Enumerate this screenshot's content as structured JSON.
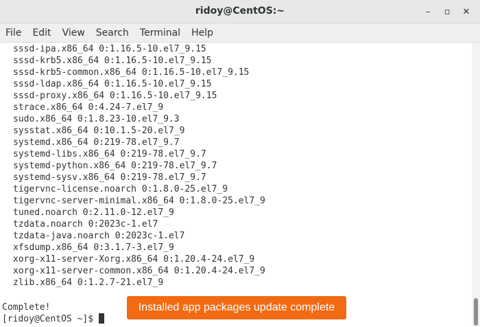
{
  "window": {
    "title": "ridoy@CentOS:~",
    "controls": {
      "minimize_icon": "–",
      "maximize_icon": "▫",
      "close_icon": "✕"
    }
  },
  "menu": [
    "File",
    "Edit",
    "View",
    "Search",
    "Terminal",
    "Help"
  ],
  "terminal": {
    "lines": [
      "sssd-ipa.x86_64 0:1.16.5-10.el7_9.15",
      "sssd-krb5.x86_64 0:1.16.5-10.el7_9.15",
      "sssd-krb5-common.x86_64 0:1.16.5-10.el7_9.15",
      "sssd-ldap.x86_64 0:1.16.5-10.el7_9.15",
      "sssd-proxy.x86_64 0:1.16.5-10.el7_9.15",
      "strace.x86_64 0:4.24-7.el7_9",
      "sudo.x86_64 0:1.8.23-10.el7_9.3",
      "sysstat.x86_64 0:10.1.5-20.el7_9",
      "systemd.x86_64 0:219-78.el7_9.7",
      "systemd-libs.x86_64 0:219-78.el7_9.7",
      "systemd-python.x86_64 0:219-78.el7_9.7",
      "systemd-sysv.x86_64 0:219-78.el7_9.7",
      "tigervnc-license.noarch 0:1.8.0-25.el7_9",
      "tigervnc-server-minimal.x86_64 0:1.8.0-25.el7_9",
      "tuned.noarch 0:2.11.0-12.el7_9",
      "tzdata.noarch 0:2023c-1.el7",
      "tzdata-java.noarch 0:2023c-1.el7",
      "xfsdump.x86_64 0:3.1.7-3.el7_9",
      "xorg-x11-server-Xorg.x86_64 0:1.20.4-24.el7_9",
      "xorg-x11-server-common.x86_64 0:1.20.4-24.el7_9",
      "zlib.x86_64 0:1.2.7-21.el7_9"
    ],
    "complete_text": "Complete!",
    "prompt": "[ridoy@CentOS ~]$ "
  },
  "toast": {
    "text": "Installed app packages update complete",
    "color": "#f26a13"
  }
}
